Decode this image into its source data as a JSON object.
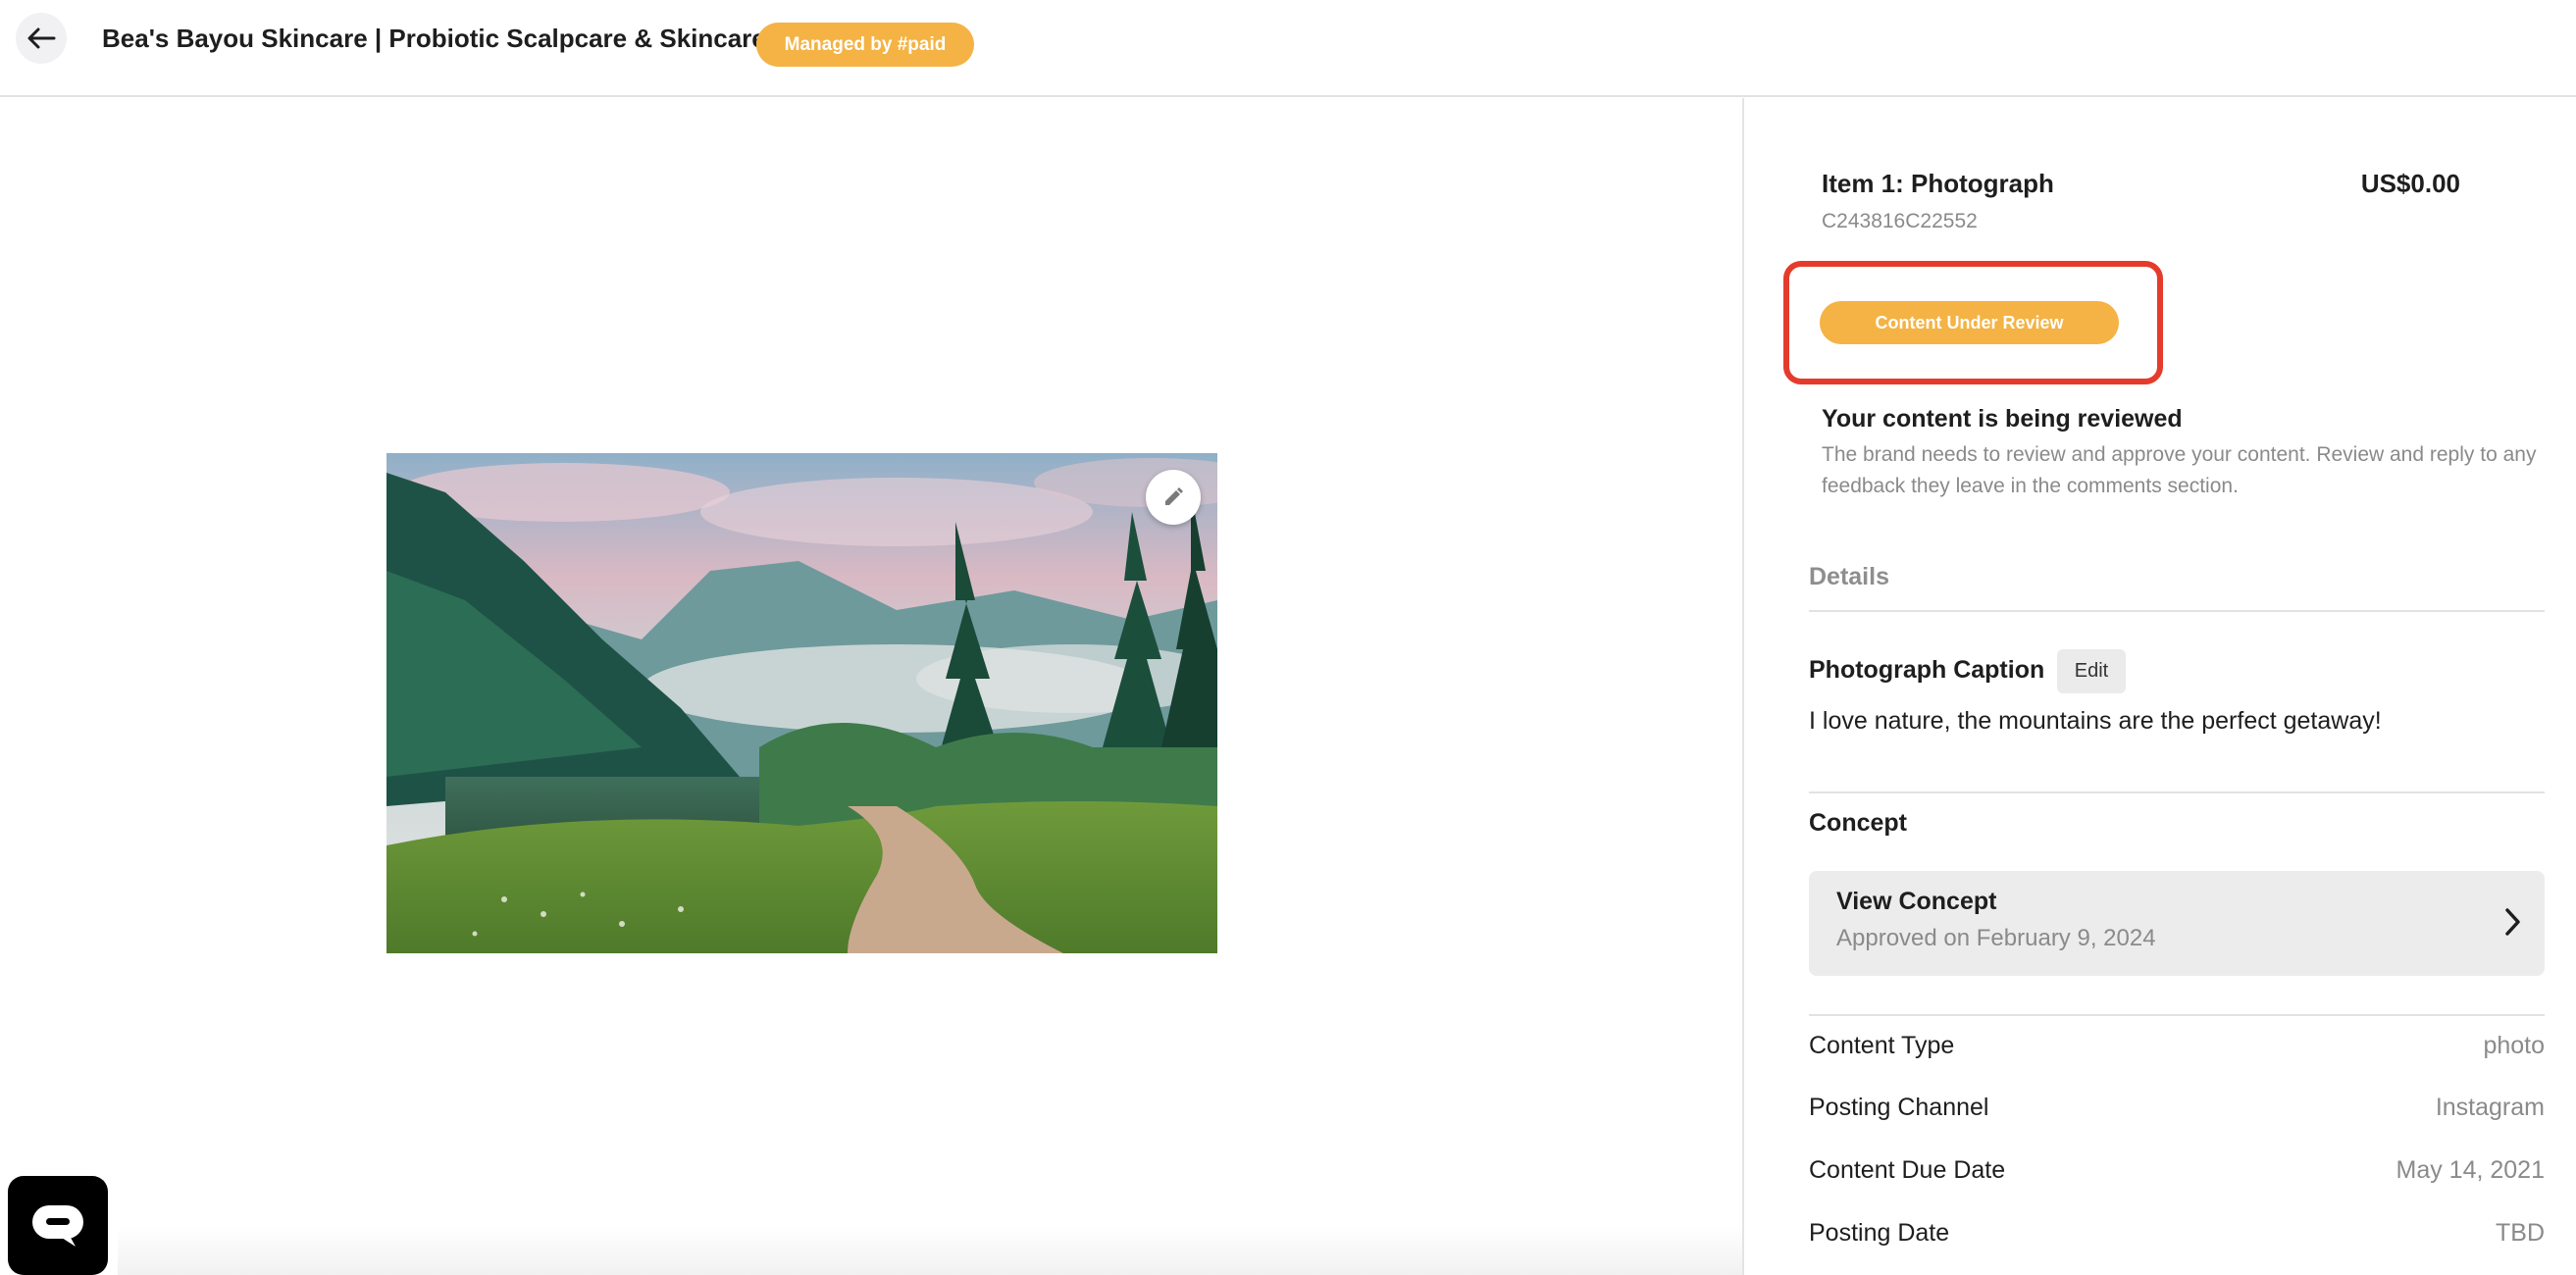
{
  "header": {
    "title": "Bea's Bayou Skincare | Probiotic Scalpcare & Skincare",
    "badge": "Managed by #paid"
  },
  "item": {
    "title": "Item 1: Photograph",
    "price": "US$0.00",
    "id": "C243816C22552",
    "status": "Content Under Review"
  },
  "review": {
    "heading": "Your content is being reviewed",
    "description": "The brand needs to review and approve your content. Review and reply to any feedback they leave in the comments section."
  },
  "details": {
    "tab_label": "Details",
    "caption_label": "Photograph Caption",
    "edit_label": "Edit",
    "caption_text": "I love nature, the mountains are the perfect getaway!",
    "concept_label": "Concept",
    "concept_card": {
      "title": "View Concept",
      "subtitle": "Approved on February 9, 2024"
    },
    "meta": [
      {
        "key": "Content Type",
        "value": "photo"
      },
      {
        "key": "Posting Channel",
        "value": "Instagram"
      },
      {
        "key": "Content Due Date",
        "value": "May 14, 2021"
      },
      {
        "key": "Posting Date",
        "value": "TBD"
      }
    ]
  },
  "colors": {
    "accent": "#f4b344",
    "highlight": "#e53b2c"
  },
  "icons": {
    "back": "arrow-left-icon",
    "edit_photo": "pencil-icon",
    "chat": "chat-bubble-icon",
    "concept_chevron": "chevron-right-icon"
  }
}
